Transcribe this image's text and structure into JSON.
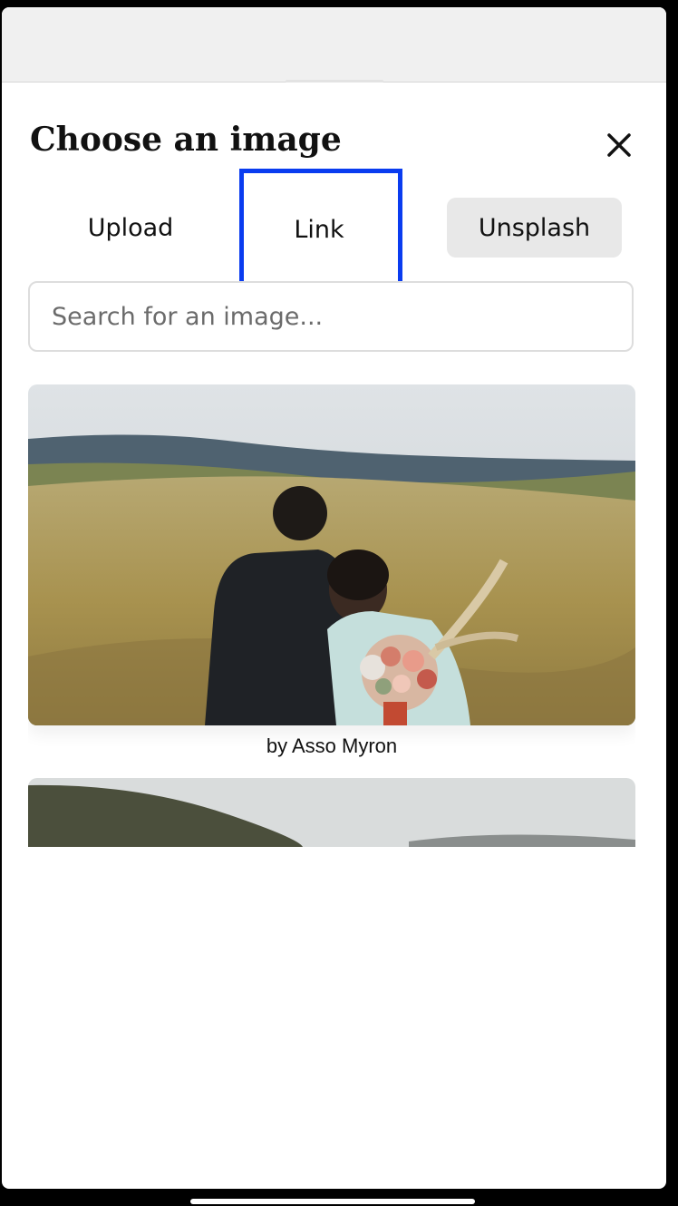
{
  "dialog": {
    "title": "Choose an image",
    "close_icon": "close-icon"
  },
  "tabs": [
    {
      "label": "Upload",
      "selected": false
    },
    {
      "label": "Link",
      "selected": false
    },
    {
      "label": "Unsplash",
      "selected": true
    }
  ],
  "search": {
    "placeholder": "Search for an image...",
    "value": ""
  },
  "results": [
    {
      "credit": "by Asso Myron",
      "subject": "couple-in-grass-field-photo"
    },
    {
      "credit": "",
      "subject": "misty-hills-photo"
    }
  ],
  "colors": {
    "highlight": "#0a3cf0",
    "selected_tab_bg": "#e8e8e8"
  }
}
